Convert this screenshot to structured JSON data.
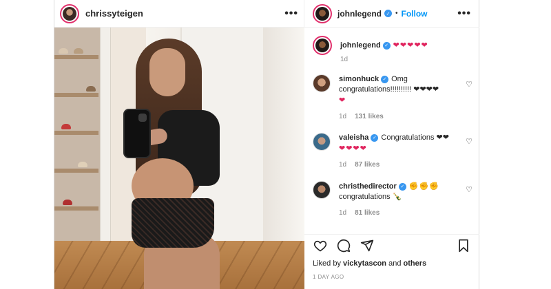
{
  "post": {
    "author": "chrissyteigen",
    "more_icon": "more-horizontal-icon"
  },
  "panel": {
    "owner": "johnlegend",
    "follow_label": "Follow",
    "bullet": "•"
  },
  "caption": {
    "user": "johnlegend",
    "text": "❤❤❤❤❤",
    "age": "1d"
  },
  "comments": [
    {
      "user": "simonhuck",
      "verified": true,
      "text": "Omg congratulations!!!!!!!!!! ❤❤❤❤",
      "extra": "❤",
      "age": "1d",
      "likes": "131 likes"
    },
    {
      "user": "valeisha",
      "verified": true,
      "text": "Congratulations ❤❤",
      "extra": "❤❤❤❤",
      "age": "1d",
      "likes": "87 likes"
    },
    {
      "user": "christhedirector",
      "verified": true,
      "text": "✊✊✊",
      "extra": "congratulations 🍾",
      "age": "1d",
      "likes": "81 likes"
    }
  ],
  "actions": {
    "like_icon": "heart-outline-icon",
    "comment_icon": "comment-icon",
    "share_icon": "send-icon",
    "save_icon": "bookmark-icon"
  },
  "liked_by": {
    "prefix": "Liked by",
    "user": "vickytascon",
    "joiner": "and",
    "others": "others"
  },
  "date": "1 DAY AGO"
}
